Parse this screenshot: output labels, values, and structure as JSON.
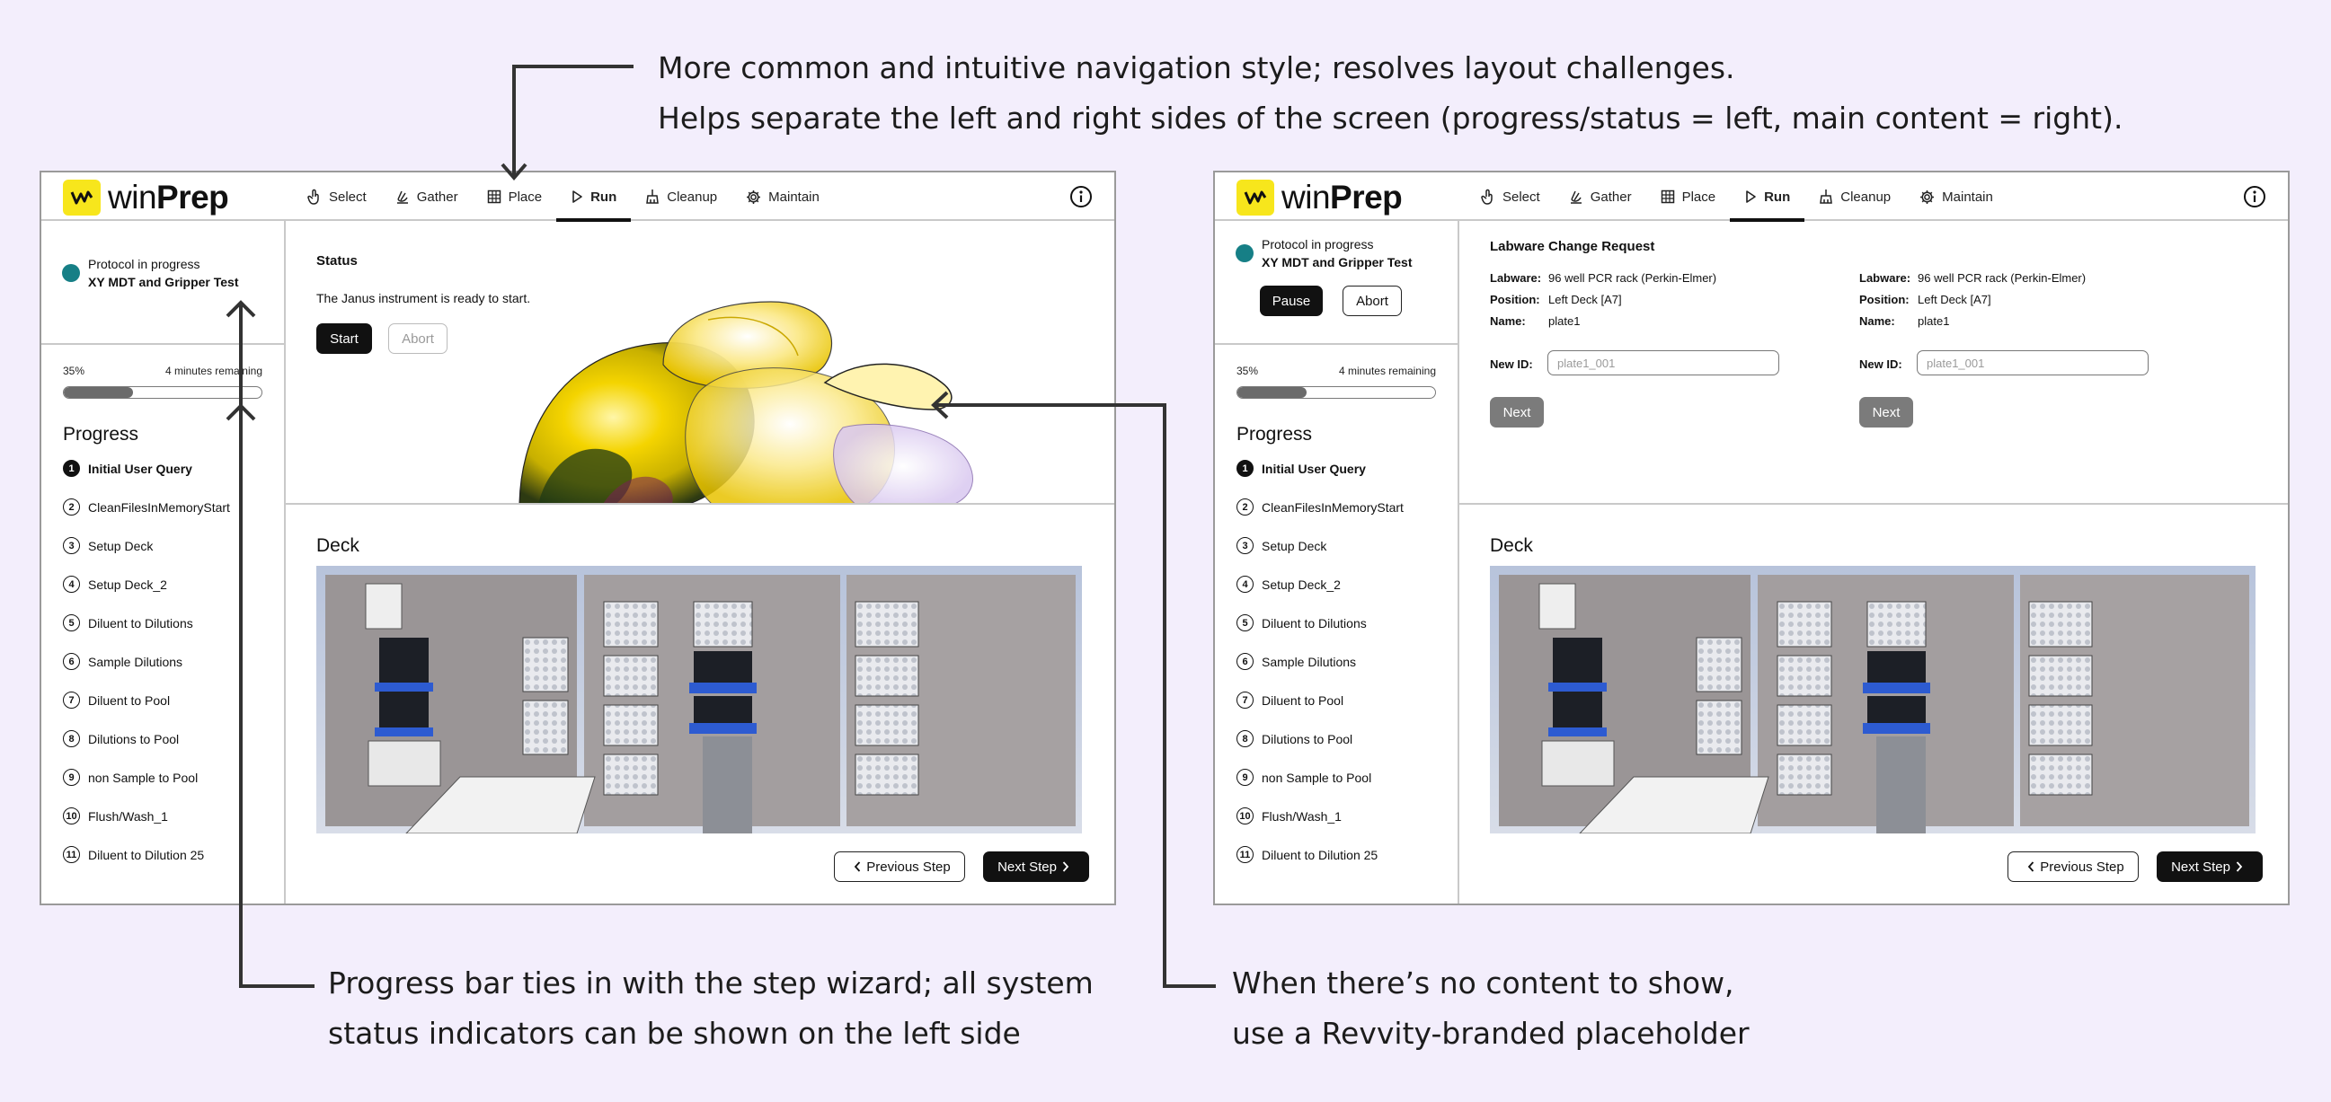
{
  "annotations": {
    "top_line1": "More common and intuitive navigation style; resolves layout challenges.",
    "top_line2": "Helps separate the left and right sides of the screen (progress/status = left, main content = right).",
    "bottom_left_line1": "Progress bar ties in with the step wizard; all system",
    "bottom_left_line2": "status indicators can be shown on the left side",
    "bottom_right_line1": "When there’s no content to show,",
    "bottom_right_line2": "use a Revvity-branded placeholder"
  },
  "app": {
    "logo_light": "win",
    "logo_bold": "Prep",
    "nav": [
      {
        "label": "Select",
        "icon": "hand-pointer-icon"
      },
      {
        "label": "Gather",
        "icon": "grab-hand-icon"
      },
      {
        "label": "Place",
        "icon": "grid-icon"
      },
      {
        "label": "Run",
        "icon": "play-icon",
        "active": true
      },
      {
        "label": "Cleanup",
        "icon": "broom-icon"
      },
      {
        "label": "Maintain",
        "icon": "gear-icon"
      }
    ],
    "info_icon": "info-icon",
    "progress_percent": 35,
    "progress_percent_label": "35%",
    "time_remaining": "4 minutes remaining",
    "progress_heading": "Progress",
    "steps": [
      {
        "num": "1",
        "label": "Initial User Query",
        "current": true
      },
      {
        "num": "2",
        "label": "CleanFilesInMemoryStart"
      },
      {
        "num": "3",
        "label": "Setup Deck"
      },
      {
        "num": "4",
        "label": "Setup Deck_2"
      },
      {
        "num": "5",
        "label": "Diluent to Dilutions"
      },
      {
        "num": "6",
        "label": "Sample Dilutions"
      },
      {
        "num": "7",
        "label": "Diluent to Pool"
      },
      {
        "num": "8",
        "label": "Dilutions to Pool"
      },
      {
        "num": "9",
        "label": "non Sample to Pool"
      },
      {
        "num": "10",
        "label": "Flush/Wash_1"
      },
      {
        "num": "11",
        "label": "Diluent to Dilution 25"
      }
    ],
    "deck_title": "Deck",
    "previous_step": "Previous Step",
    "next_step": "Next Step"
  },
  "left_screen": {
    "protocol_status": "Protocol in progress",
    "protocol_name": "XY MDT and Gripper Test",
    "status_title": "Status",
    "status_message": "The Janus instrument is ready to start.",
    "start_label": "Start",
    "abort_label": "Abort"
  },
  "right_screen": {
    "protocol_status": "Protocol in progress",
    "protocol_name": "XY MDT and Gripper Test",
    "pause_label": "Pause",
    "abort_label": "Abort",
    "labware_title": "Labware Change Request",
    "requests": [
      {
        "labware_key": "Labware:",
        "labware": "96 well PCR rack (Perkin-Elmer)",
        "position_key": "Position:",
        "position": "Left Deck [A7]",
        "name_key": "Name:",
        "name": "plate1",
        "new_id_label": "New ID:",
        "new_id_placeholder": "plate1_001",
        "next_label": "Next"
      },
      {
        "labware_key": "Labware:",
        "labware": "96 well PCR rack (Perkin-Elmer)",
        "position_key": "Position:",
        "position": "Left Deck [A7]",
        "name_key": "Name:",
        "name": "plate1",
        "new_id_label": "New ID:",
        "new_id_placeholder": "plate1_001",
        "next_label": "Next"
      }
    ]
  },
  "colors": {
    "background": "#f3eefc",
    "logo_yellow": "#f7e61c",
    "status_dot": "#167f86",
    "primary_button": "#111111"
  }
}
